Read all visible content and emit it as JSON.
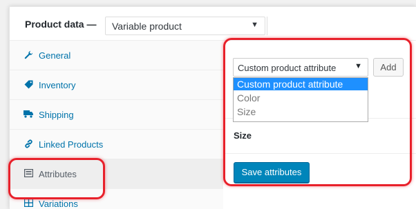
{
  "header": {
    "title": "Product data —",
    "product_type": "Variable product"
  },
  "sidebar": {
    "items": [
      {
        "label": "General",
        "icon": "wrench-icon"
      },
      {
        "label": "Inventory",
        "icon": "tag-icon"
      },
      {
        "label": "Shipping",
        "icon": "truck-icon"
      },
      {
        "label": "Linked Products",
        "icon": "link-icon"
      },
      {
        "label": "Attributes",
        "icon": "list-icon"
      },
      {
        "label": "Variations",
        "icon": "grid-icon"
      }
    ],
    "active_index": 4
  },
  "attributes": {
    "select_value": "Custom product attribute",
    "add_label": "Add",
    "options": [
      "Custom product attribute",
      "Color",
      "Size"
    ],
    "highlighted_option": 0,
    "attribute_name": "Size",
    "save_label": "Save attributes"
  },
  "colors": {
    "link": "#0073aa",
    "primary_button": "#0085ba",
    "highlight": "#e8202a",
    "dropdown_selected": "#1e90ff"
  }
}
